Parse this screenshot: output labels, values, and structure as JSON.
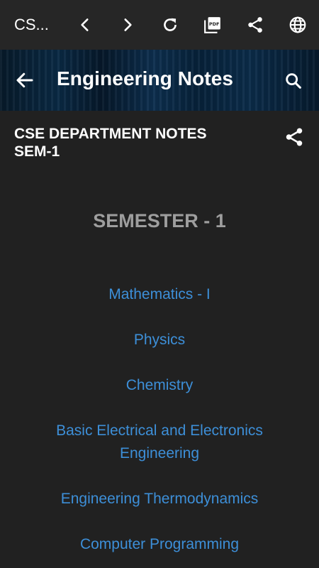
{
  "browser_bar": {
    "title": "CS...",
    "icons": [
      "back-icon",
      "forward-icon",
      "refresh-icon",
      "pdf-icon",
      "share-icon",
      "globe-icon"
    ]
  },
  "header": {
    "title": "Engineering Notes"
  },
  "notes": {
    "title_line1": "CSE DEPARTMENT NOTES",
    "title_line2": "SEM-1",
    "semester_heading": "SEMESTER - 1",
    "links": [
      "Mathematics - I",
      "Physics",
      "Chemistry",
      "Basic Electrical and Electronics Engineering",
      "Engineering Thermodynamics",
      "Computer Programming"
    ]
  },
  "colors": {
    "background": "#212121",
    "link": "#3d8fd8",
    "heading_gray": "#9e9e9e"
  }
}
